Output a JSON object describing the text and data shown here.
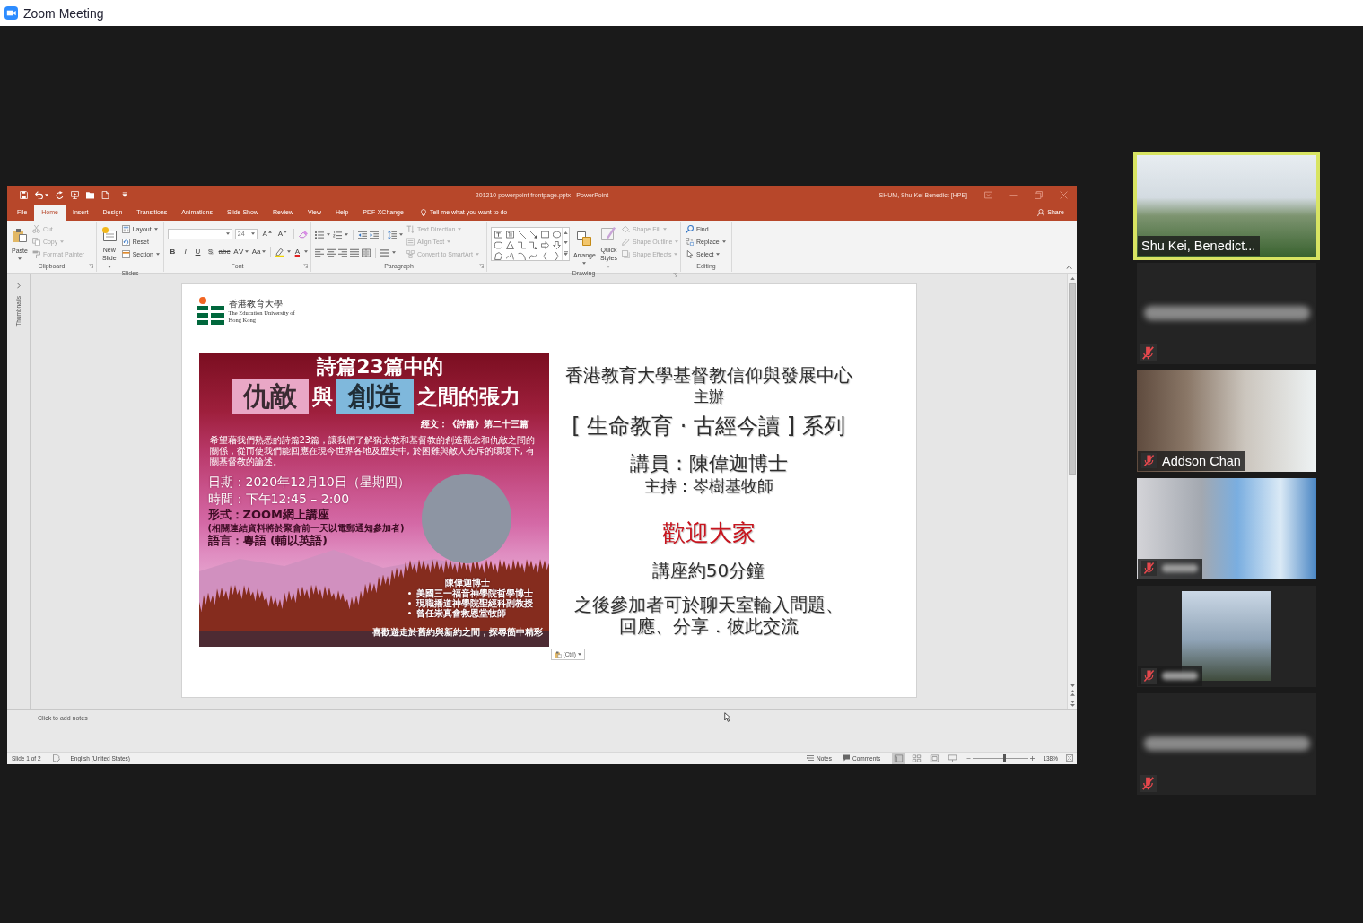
{
  "window": {
    "title": "Zoom Meeting"
  },
  "powerpoint": {
    "title": "201210 powerpoint frontpage.pptx - PowerPoint",
    "user": "SHUM, Shu Kei Benedict [HPE]",
    "tabs": [
      {
        "label": "File",
        "selected": false
      },
      {
        "label": "Home",
        "selected": true
      },
      {
        "label": "Insert",
        "selected": false
      },
      {
        "label": "Design",
        "selected": false
      },
      {
        "label": "Transitions",
        "selected": false
      },
      {
        "label": "Animations",
        "selected": false
      },
      {
        "label": "Slide Show",
        "selected": false
      },
      {
        "label": "Review",
        "selected": false
      },
      {
        "label": "View",
        "selected": false
      },
      {
        "label": "Help",
        "selected": false
      },
      {
        "label": "PDF-XChange",
        "selected": false
      }
    ],
    "tell_me": "Tell me what you want to do",
    "share": "Share",
    "ribbon": {
      "clipboard": {
        "label": "Clipboard",
        "launcher": true,
        "paste": "Paste",
        "items": [
          {
            "label": "Cut",
            "disabled": true,
            "menu": false
          },
          {
            "label": "Copy",
            "disabled": true,
            "menu": true
          },
          {
            "label": "Format Painter",
            "disabled": true,
            "menu": false
          }
        ]
      },
      "slides": {
        "label": "Slides",
        "new_slide": "New Slide",
        "items": [
          {
            "label": "Layout",
            "menu": true
          },
          {
            "label": "Reset",
            "menu": false
          },
          {
            "label": "Section",
            "menu": true
          }
        ]
      },
      "font": {
        "label": "Font",
        "launcher": true,
        "size": "24",
        "size_buttons": [
          "A",
          "A"
        ],
        "format_buttons": [
          {
            "label": "B",
            "menu": false
          },
          {
            "label": "I",
            "menu": false
          },
          {
            "label": "U",
            "menu": false
          },
          {
            "label": "S",
            "menu": false
          },
          {
            "label": "abc",
            "menu": false
          },
          {
            "label": "AV",
            "menu": true
          },
          {
            "label": "Aa",
            "menu": true
          }
        ],
        "color_button": "A"
      },
      "paragraph": {
        "label": "Paragraph",
        "launcher": true,
        "items": [
          {
            "label": "Text Direction",
            "disabled": true,
            "menu": true
          },
          {
            "label": "Align Text",
            "disabled": true,
            "menu": true
          },
          {
            "label": "Convert to SmartArt",
            "disabled": true,
            "menu": true
          }
        ]
      },
      "drawing": {
        "label": "Drawing",
        "launcher": true,
        "arrange": "Arrange",
        "quick_styles": {
          "label": "Quick Styles",
          "disabled": true
        },
        "items": [
          {
            "label": "Shape Fill",
            "disabled": true,
            "menu": true
          },
          {
            "label": "Shape Outline",
            "disabled": true,
            "menu": true
          },
          {
            "label": "Shape Effects",
            "disabled": true,
            "menu": true
          }
        ]
      },
      "editing": {
        "label": "Editing",
        "items": [
          {
            "label": "Find",
            "menu": false
          },
          {
            "label": "Replace",
            "menu": true
          },
          {
            "label": "Select",
            "menu": true
          }
        ]
      }
    },
    "thumbnails_label": "Thumbnails",
    "slide": {
      "logo": {
        "chinese": "香港教育大學",
        "english": "The Education University of Hong Kong"
      },
      "poster": {
        "title": "詩篇23篇中的",
        "theme": [
          {
            "text": "仇敵",
            "kind": "boxed",
            "color": "#e9a7c6"
          },
          {
            "text": "與",
            "kind": "plain"
          },
          {
            "text": "創造",
            "kind": "boxed",
            "color": "#7fb8dc"
          },
          {
            "text": "之間的張力",
            "kind": "plain"
          }
        ],
        "scripture": "經文：《詩篇》第二十三篇",
        "description": "希望藉我們熟悉的詩篇23篇，讓我們了解猶太教和基督教的創造觀念和仇敵之間的關係，從而使我們能回應在現今世界各地及歷史中, 於困難與敵人充斥的環境下, 有關基督教的論述。",
        "details": [
          {
            "text": "日期：2020年12月10日（星期四）",
            "kind": "highlight"
          },
          {
            "text": "時間：下午12:45 – 2:00",
            "kind": "highlight"
          },
          {
            "text": "形式：ZOOM網上講座",
            "kind": "main"
          },
          {
            "text": "(相關連結資料將於聚會前一天以電郵通知參加者)",
            "kind": "note"
          },
          {
            "text": "語言：粵語 (輔以英語)",
            "kind": "main"
          }
        ],
        "speaker": "陳偉迦博士",
        "credentials": [
          "美國三一福音神學院哲學博士",
          "現職播道神學院聖經科副教授",
          "曾任崇真會救恩堂牧師"
        ],
        "tagline": "喜歡遊走於舊約與新約之間，探尋箇中精彩"
      },
      "lines": [
        {
          "text": "香港教育大學基督教信仰與發展中心",
          "kind": "organiser"
        },
        {
          "text": "主辦",
          "kind": "subtitle"
        },
        {
          "text": "[ 生命教育 · 古經今讀 ] 系列",
          "kind": "series"
        },
        {
          "text": "講員：陳偉迦博士",
          "kind": "speaker"
        },
        {
          "text": "主持：岑樹基牧師",
          "kind": "host"
        },
        {
          "text": "歡迎大家",
          "kind": "welcome"
        },
        {
          "text": "講座約50分鐘",
          "kind": "duration"
        },
        {
          "text": "之後參加者可於聊天室輸入問題、回應、分享．彼此交流",
          "kind": "closing"
        }
      ]
    },
    "paste_options": "(Ctrl)",
    "notes": {
      "placeholder": "Click to add notes"
    },
    "status_bar": {
      "slide": "Slide 1 of 2",
      "language": "English (United States)",
      "notes": "Notes",
      "comments": "Comments",
      "views": [
        {
          "selected": true
        },
        {
          "selected": false
        },
        {
          "selected": false
        },
        {
          "selected": false
        }
      ],
      "zoom": {
        "level": 0.56
      },
      "zoom_percent": "138%"
    }
  },
  "participants": [
    {
      "name": "Shu Kei, Benedict...",
      "kind": "video",
      "speaking": true,
      "muted": false
    },
    {
      "kind": "blank",
      "speaking": false,
      "muted": true
    },
    {
      "name": "Addson Chan",
      "kind": "video",
      "speaking": false,
      "muted": true
    },
    {
      "kind": "video",
      "speaking": false,
      "muted": true
    },
    {
      "kind": "photo",
      "speaking": false,
      "muted": true
    },
    {
      "kind": "blank",
      "speaking": false,
      "muted": true
    }
  ]
}
